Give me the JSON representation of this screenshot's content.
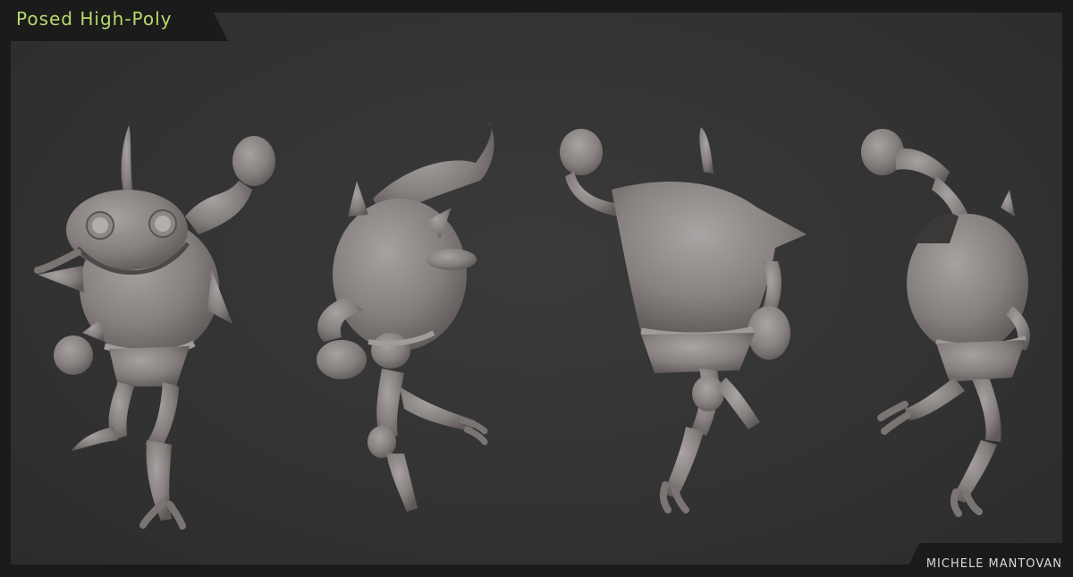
{
  "header": {
    "title": "Posed High-Poly"
  },
  "footer": {
    "author": "MICHELE MANTOVAN"
  },
  "colors": {
    "title_accent": "#b6da6e",
    "background": "#333333",
    "frame": "#1b1b1b",
    "clay": "#8a8585"
  },
  "figures": [
    {
      "view": "front-view"
    },
    {
      "view": "three-quarter-view"
    },
    {
      "view": "back-view"
    },
    {
      "view": "side-view"
    }
  ]
}
